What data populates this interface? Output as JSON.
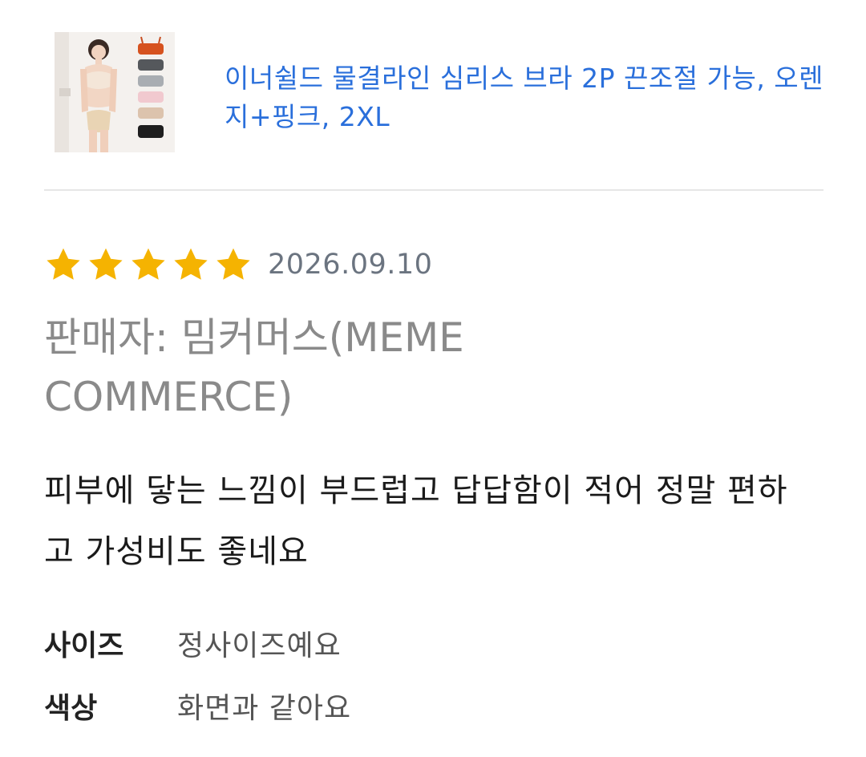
{
  "product": {
    "title": "이너쉴드 물결라인 심리스 브라 2P 끈조절 가능, 오렌지+핑크, 2XL"
  },
  "review": {
    "rating": 5,
    "rating_max": 5,
    "date": "2026.09.10",
    "seller": "판매자: 밈커머스(MEME COMMERCE)",
    "body": "피부에 닿는 느낌이 부드럽고 답답함이 적어 정말 편하고 가성비도 좋네요",
    "attributes": [
      {
        "label": "사이즈",
        "value": "정사이즈예요"
      },
      {
        "label": "색상",
        "value": "화면과 같아요"
      }
    ]
  },
  "colors": {
    "link": "#2a6fdb",
    "star": "#f5b301",
    "date": "#6b7480",
    "seller": "#8a8a8a",
    "divider": "#e6e6e6"
  },
  "icons": {
    "star": "star-filled-icon",
    "thumbnail": "product-thumbnail"
  }
}
